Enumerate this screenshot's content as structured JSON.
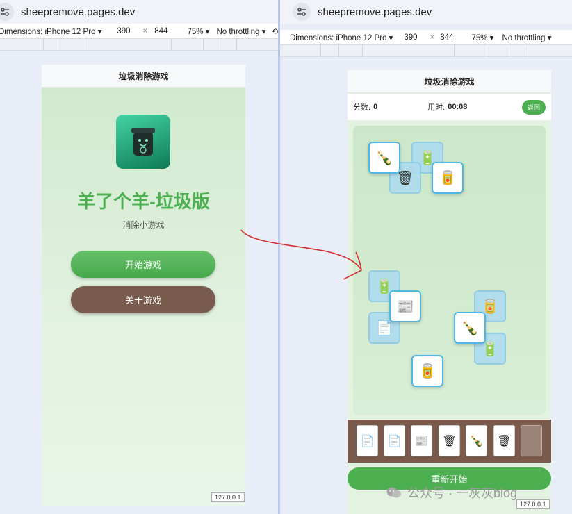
{
  "browser": {
    "url": "sheepremove.pages.dev",
    "dimensions_label": "Dimensions: iPhone 12 Pro",
    "width": "390",
    "times": "×",
    "height": "844",
    "zoom": "75%",
    "throttling": "No throttling",
    "caret": "▾"
  },
  "left_screen": {
    "header_title": "垃圾消除游戏",
    "app_title": "羊了个羊-垃圾版",
    "subtitle": "消除小游戏",
    "start_button": "开始游戏",
    "about_button": "关于游戏",
    "ip_badge": "127.0.0.1"
  },
  "right_screen": {
    "header_title": "垃圾消除游戏",
    "score_label": "分数:",
    "score_value": "0",
    "time_label": "用时:",
    "time_value": "00:08",
    "back_button": "返回",
    "restart_button": "重新开始",
    "ip_badge": "127.0.0.1",
    "board_tiles": [
      {
        "icon": "bottle",
        "layer": "top"
      },
      {
        "icon": "battery",
        "layer": "under"
      },
      {
        "icon": "trash-bin",
        "layer": "under"
      },
      {
        "icon": "can",
        "layer": "top"
      },
      {
        "icon": "battery",
        "layer": "under"
      },
      {
        "icon": "newspaper",
        "layer": "top"
      },
      {
        "icon": "paper",
        "layer": "under"
      },
      {
        "icon": "can",
        "layer": "under"
      },
      {
        "icon": "bottle",
        "layer": "top"
      },
      {
        "icon": "battery",
        "layer": "under"
      },
      {
        "icon": "can",
        "layer": "top"
      }
    ],
    "tray_slots": [
      "paper",
      "paper",
      "newspaper",
      "trash-bin",
      "bottle",
      "trash-bin",
      "empty"
    ]
  },
  "watermark": "公众号 · 一灰灰blog",
  "colors": {
    "accent_green": "#4caf50",
    "brown_button": "#7a5a4a",
    "title_green": "#4caf50",
    "tile_border": "#4fb6e6",
    "arrow_red": "#d32f2f"
  }
}
